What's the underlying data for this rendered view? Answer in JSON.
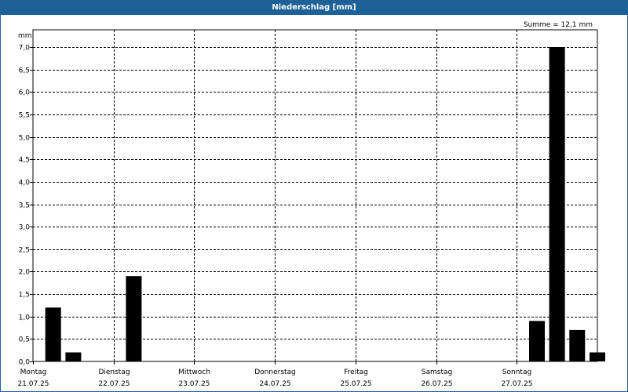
{
  "header": {
    "title": "Niederschlag [mm]"
  },
  "chart_data": {
    "type": "bar",
    "title": "Niederschlag [mm]",
    "summary": "Summe = 12,1 mm",
    "ylabel": "mm",
    "ylim": [
      0,
      7.0
    ],
    "yticks": [
      "0,0",
      "0,5",
      "1,0",
      "1,5",
      "2,0",
      "2,5",
      "3,0",
      "3,5",
      "4,0",
      "4,5",
      "5,0",
      "5,5",
      "6,0",
      "6,5",
      "7,0"
    ],
    "days": [
      {
        "weekday": "Montag",
        "date": "21.07.25"
      },
      {
        "weekday": "Dienstag",
        "date": "22.07.25"
      },
      {
        "weekday": "Mittwoch",
        "date": "23.07.25"
      },
      {
        "weekday": "Donnerstag",
        "date": "24.07.25"
      },
      {
        "weekday": "Freitag",
        "date": "25.07.25"
      },
      {
        "weekday": "Samstag",
        "date": "26.07.25"
      },
      {
        "weekday": "Sonntag",
        "date": "27.07.25"
      }
    ],
    "interval": "6h",
    "values": [
      0,
      1.2,
      0.2,
      0,
      0,
      1.9,
      0,
      0,
      0,
      0,
      0,
      0,
      0,
      0,
      0,
      0,
      0,
      0,
      0,
      0,
      0,
      0,
      0,
      0,
      0,
      0.9,
      7.0,
      0.7,
      0.2
    ],
    "grid": true,
    "bar_color": "#000000"
  }
}
